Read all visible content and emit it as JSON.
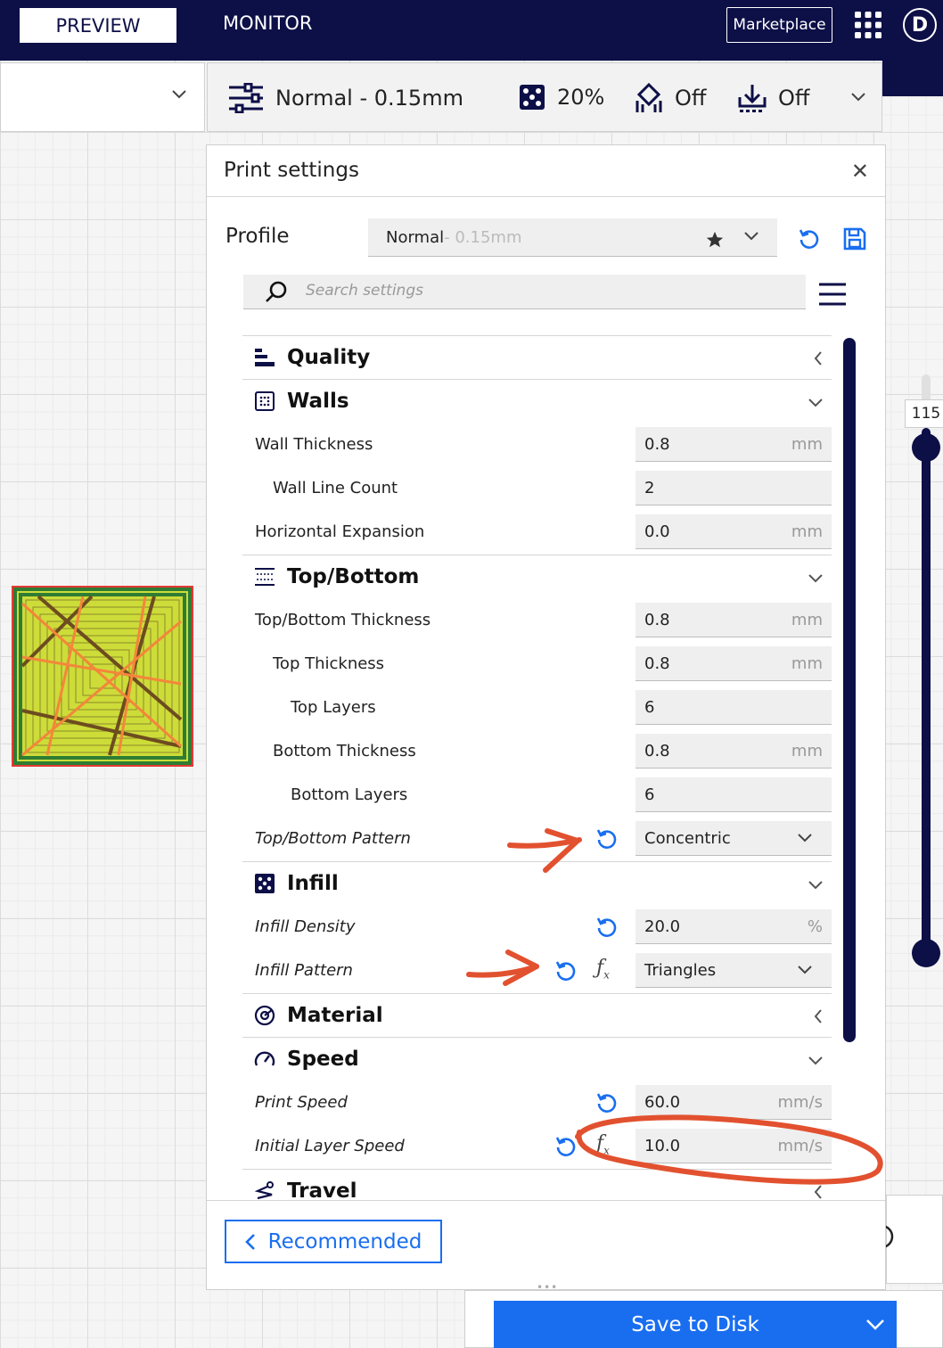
{
  "topbar": {
    "preview_tab": "PREVIEW",
    "monitor_tab": "MONITOR",
    "marketplace": "Marketplace",
    "avatar": "D"
  },
  "print_bar": {
    "profile": "Normal - 0.15mm",
    "infill": "20%",
    "support": "Off",
    "adhesion": "Off"
  },
  "panel": {
    "title": "Print settings",
    "profile_label": "Profile",
    "profile_name": "Normal",
    "profile_suffix": " - 0.15mm",
    "search_placeholder": "Search settings"
  },
  "categories": {
    "quality": "Quality",
    "walls": "Walls",
    "top_bottom": "Top/Bottom",
    "infill": "Infill",
    "material": "Material",
    "speed": "Speed",
    "travel": "Travel"
  },
  "settings": {
    "wall_thickness": {
      "label": "Wall Thickness",
      "value": "0.8",
      "unit": "mm"
    },
    "wall_line_count": {
      "label": "Wall Line Count",
      "value": "2"
    },
    "horizontal_expansion": {
      "label": "Horizontal Expansion",
      "value": "0.0",
      "unit": "mm"
    },
    "top_bottom_thickness": {
      "label": "Top/Bottom Thickness",
      "value": "0.8",
      "unit": "mm"
    },
    "top_thickness": {
      "label": "Top Thickness",
      "value": "0.8",
      "unit": "mm"
    },
    "top_layers": {
      "label": "Top Layers",
      "value": "6"
    },
    "bottom_thickness": {
      "label": "Bottom Thickness",
      "value": "0.8",
      "unit": "mm"
    },
    "bottom_layers": {
      "label": "Bottom Layers",
      "value": "6"
    },
    "top_bottom_pattern": {
      "label": "Top/Bottom Pattern",
      "value": "Concentric"
    },
    "infill_density": {
      "label": "Infill Density",
      "value": "20.0",
      "unit": "%"
    },
    "infill_pattern": {
      "label": "Infill Pattern",
      "value": "Triangles"
    },
    "print_speed": {
      "label": "Print Speed",
      "value": "60.0",
      "unit": "mm/s"
    },
    "initial_layer_speed": {
      "label": "Initial Layer Speed",
      "value": "10.0",
      "unit": "mm/s"
    }
  },
  "footer": {
    "recommended": "Recommended",
    "save_to_disk": "Save to Disk"
  },
  "layer_slider": {
    "value": "115"
  },
  "icons": [
    "settings-sliders-icon",
    "infill-icon",
    "support-icon",
    "adhesion-icon",
    "star-icon",
    "chevron-down-icon",
    "reset-icon",
    "save-icon",
    "search-icon",
    "menu-icon",
    "quality-icon",
    "walls-icon",
    "top-bottom-icon",
    "material-icon",
    "speed-icon",
    "travel-icon",
    "function-icon",
    "chevron-left-icon",
    "close-icon"
  ],
  "colors": {
    "navy": "#0d0f47",
    "accent_blue": "#196ef0",
    "annotation_red": "#e2512f"
  }
}
